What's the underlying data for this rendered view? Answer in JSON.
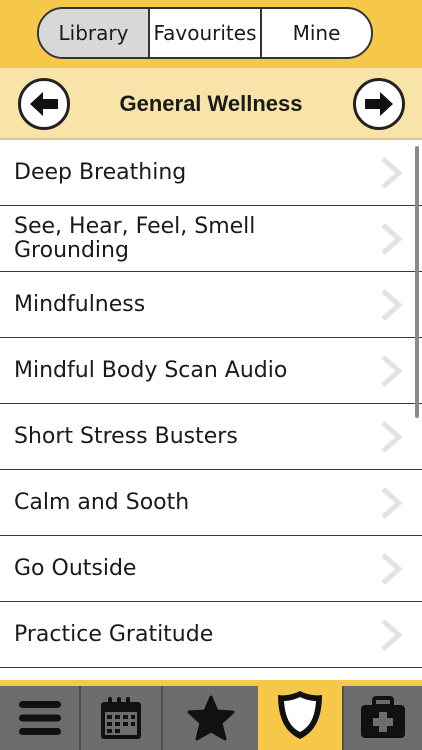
{
  "tabs": {
    "library": "Library",
    "favourites": "Favourites",
    "mine": "Mine"
  },
  "category": {
    "title": "General Wellness"
  },
  "items": [
    "Deep Breathing",
    "See, Hear, Feel, Smell Grounding",
    "Mindfulness",
    "Mindful Body Scan Audio",
    "Short Stress Busters",
    "Calm and Sooth",
    "Go Outside",
    "Practice Gratitude"
  ],
  "bottom_nav": [
    "menu-icon",
    "calendar-icon",
    "star-icon",
    "shield-icon",
    "first-aid-kit-icon"
  ],
  "colors": {
    "accent": "#f5c84a",
    "accent_light": "#f8e4a8",
    "tabbar": "#6d6d6d"
  }
}
